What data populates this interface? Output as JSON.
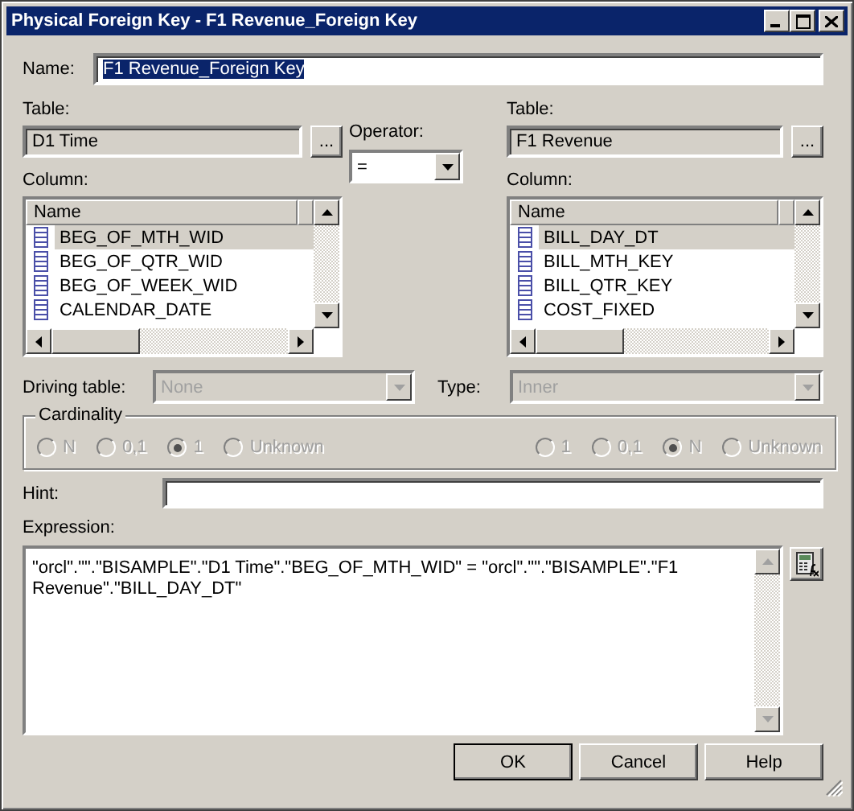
{
  "window": {
    "title": "Physical Foreign Key - F1 Revenue_Foreign Key"
  },
  "name_field": {
    "label": "Name:",
    "value": "F1 Revenue_Foreign Key",
    "selected": true
  },
  "tables": [
    {
      "table_label": "Table:",
      "table_value": "D1 Time",
      "browse": "...",
      "column_label": "Column:",
      "list_header": "Name",
      "columns": [
        {
          "name": "BEG_OF_MTH_WID",
          "selected": true
        },
        {
          "name": "BEG_OF_QTR_WID",
          "selected": false
        },
        {
          "name": "BEG_OF_WEEK_WID",
          "selected": false
        },
        {
          "name": "CALENDAR_DATE",
          "selected": false
        }
      ]
    },
    {
      "table_label": "Table:",
      "table_value": "F1 Revenue",
      "browse": "...",
      "column_label": "Column:",
      "list_header": "Name",
      "columns": [
        {
          "name": "BILL_DAY_DT",
          "selected": true
        },
        {
          "name": "BILL_MTH_KEY",
          "selected": false
        },
        {
          "name": "BILL_QTR_KEY",
          "selected": false
        },
        {
          "name": "COST_FIXED",
          "selected": false
        }
      ]
    }
  ],
  "operator": {
    "label": "Operator:",
    "value": "="
  },
  "driving_table": {
    "label": "Driving table:",
    "value": "None",
    "disabled": true
  },
  "type": {
    "label": "Type:",
    "value": "Inner",
    "disabled": true
  },
  "cardinality": {
    "label": "Cardinality",
    "disabled": true,
    "left": [
      {
        "label": "N",
        "selected": false
      },
      {
        "label": "0,1",
        "selected": false
      },
      {
        "label": "1",
        "selected": true
      },
      {
        "label": "Unknown",
        "selected": false
      }
    ],
    "right": [
      {
        "label": "1",
        "selected": false
      },
      {
        "label": "0,1",
        "selected": false
      },
      {
        "label": "N",
        "selected": true
      },
      {
        "label": "Unknown",
        "selected": false
      }
    ]
  },
  "hint": {
    "label": "Hint:"
  },
  "expression": {
    "label": "Expression:",
    "value": "\"orcl\".\"\".\"BISAMPLE\".\"D1 Time\".\"BEG_OF_MTH_WID\" = \"orcl\".\"\".\"BISAMPLE\".\"F1 Revenue\".\"BILL_DAY_DT\""
  },
  "buttons": [
    {
      "label": "OK",
      "default": true
    },
    {
      "label": "Cancel",
      "default": false
    },
    {
      "label": "Help",
      "default": false
    }
  ]
}
